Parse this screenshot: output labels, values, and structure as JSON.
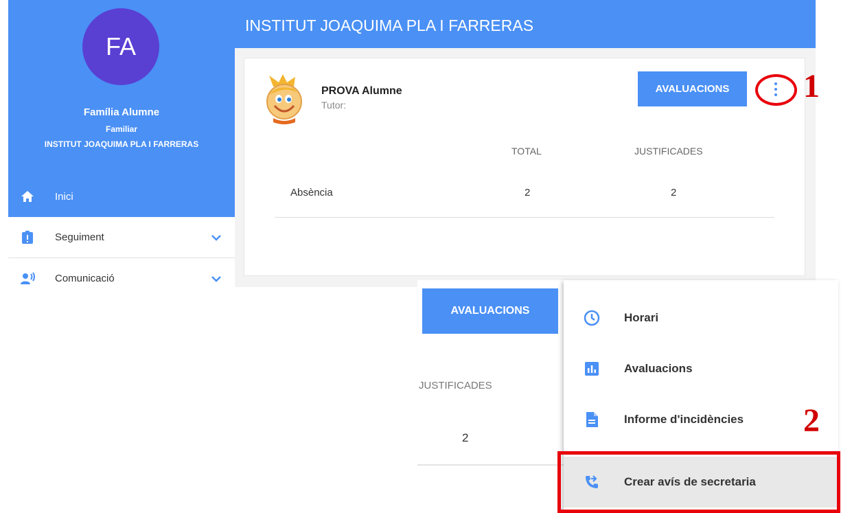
{
  "sidebar": {
    "avatar_initials": "FA",
    "user_name": "Família Alumne",
    "user_role": "Familiar",
    "school": "INSTITUT JOAQUIMA PLA I FARRERAS",
    "items": [
      {
        "label": "Inici",
        "icon": "home-icon",
        "active": true
      },
      {
        "label": "Seguiment",
        "icon": "clipboard-alert-icon",
        "active": false
      },
      {
        "label": "Comunicació",
        "icon": "people-broadcast-icon",
        "active": false
      }
    ]
  },
  "header": {
    "title": "INSTITUT JOAQUIMA PLA I FARRERAS"
  },
  "card": {
    "student_name": "PROVA Alumne",
    "tutor_label": "Tutor:",
    "avaluacions_button": "AVALUACIONS",
    "columns": [
      "TOTAL",
      "JUSTIFICADES"
    ],
    "rows": [
      {
        "label": "Absència",
        "total": "2",
        "justificades": "2"
      }
    ]
  },
  "zoom": {
    "avaluacions_button": "AVALUACIONS",
    "column_header": "JUSTIFICADES",
    "value": "2",
    "menu": [
      {
        "label": "Horari",
        "icon": "clock-icon"
      },
      {
        "label": "Avaluacions",
        "icon": "bar-chart-icon"
      },
      {
        "label": "Informe d'incidències",
        "icon": "document-icon"
      },
      {
        "label": "Crear avís de secretaria",
        "icon": "phone-forward-icon",
        "highlighted": true
      }
    ]
  },
  "annotations": {
    "marker_1": "1",
    "marker_2": "2"
  },
  "colors": {
    "primary": "#4a90f5",
    "avatar": "#5a3fd3",
    "annotation_red": "#e8000b"
  }
}
